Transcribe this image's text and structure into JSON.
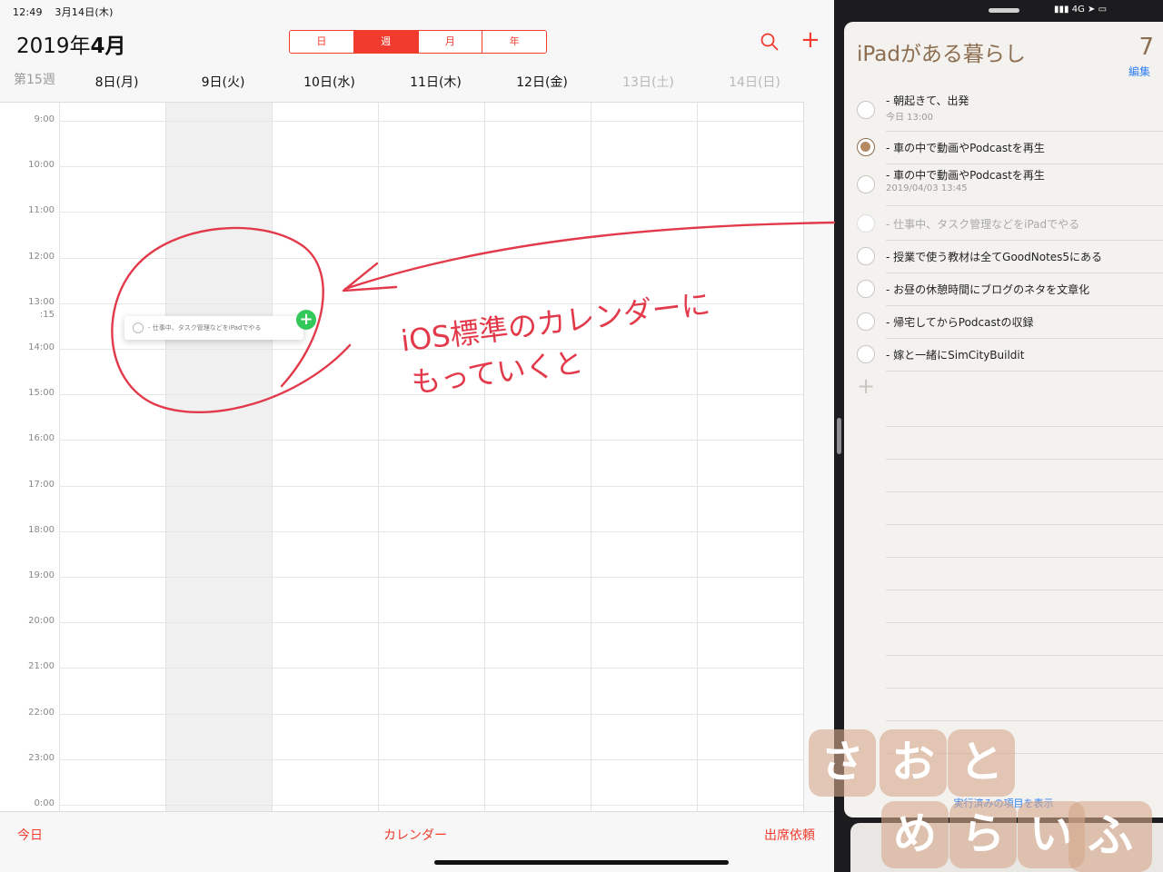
{
  "status": {
    "time": "12:49",
    "date": "3月14日(木)",
    "network": "4G"
  },
  "calendar": {
    "title_year": "2019年",
    "title_month": "4月",
    "views": [
      "日",
      "週",
      "月",
      "年"
    ],
    "active_view": "週",
    "week_number": "第15週",
    "days": [
      {
        "label": "8日(月)",
        "weekend": false
      },
      {
        "label": "9日(火)",
        "weekend": false
      },
      {
        "label": "10日(水)",
        "weekend": false
      },
      {
        "label": "11日(木)",
        "weekend": false
      },
      {
        "label": "12日(金)",
        "weekend": false
      },
      {
        "label": "13日(土)",
        "weekend": true
      },
      {
        "label": "14日(日)",
        "weekend": true
      }
    ],
    "hours": [
      "9:00",
      "10:00",
      "11:00",
      "12:00",
      "13:00",
      "14:00",
      "15:00",
      "16:00",
      "17:00",
      "18:00",
      "19:00",
      "20:00",
      "21:00",
      "22:00",
      "23:00",
      "0:00"
    ],
    "drag_time_label": ":15",
    "dragged_item": "- 仕事中、タスク管理などをiPadでやる",
    "tabs": {
      "today": "今日",
      "calendars": "カレンダー",
      "inbox": "出席依頼"
    },
    "accent": "#f03b2e"
  },
  "reminders": {
    "list_title": "iPadがある暮らし",
    "count": "7",
    "edit_label": "編集",
    "items": [
      {
        "text": "- 朝起きて、出発",
        "sub": "今日 13:00",
        "state": "open"
      },
      {
        "text": "- 車の中で動画やPodcastを再生",
        "sub": "",
        "state": "done"
      },
      {
        "text": "- 車の中で動画やPodcastを再生",
        "sub": "2019/04/03 13:45",
        "state": "open"
      },
      {
        "text": "- 仕事中、タスク管理などをiPadでやる",
        "sub": "",
        "state": "dragging"
      },
      {
        "text": "- 授業で使う教材は全てGoodNotes5にある",
        "sub": "",
        "state": "open"
      },
      {
        "text": "- お昼の休憩時間にブログのネタを文章化",
        "sub": "",
        "state": "open"
      },
      {
        "text": "- 帰宅してからPodcastの収録",
        "sub": "",
        "state": "open"
      },
      {
        "text": "- 嫁と一緒にSimCityBuildit",
        "sub": "",
        "state": "open"
      }
    ],
    "show_completed": "実行済みの項目を表示",
    "accent": "#8c6d4f"
  },
  "annotation": {
    "line1": "iOS標準のカレンダーに",
    "line2": "もっていくと",
    "color": "#e23a4a"
  },
  "watermark": [
    "さ",
    "お",
    "と",
    "め",
    "ら",
    "い",
    "ふ"
  ]
}
